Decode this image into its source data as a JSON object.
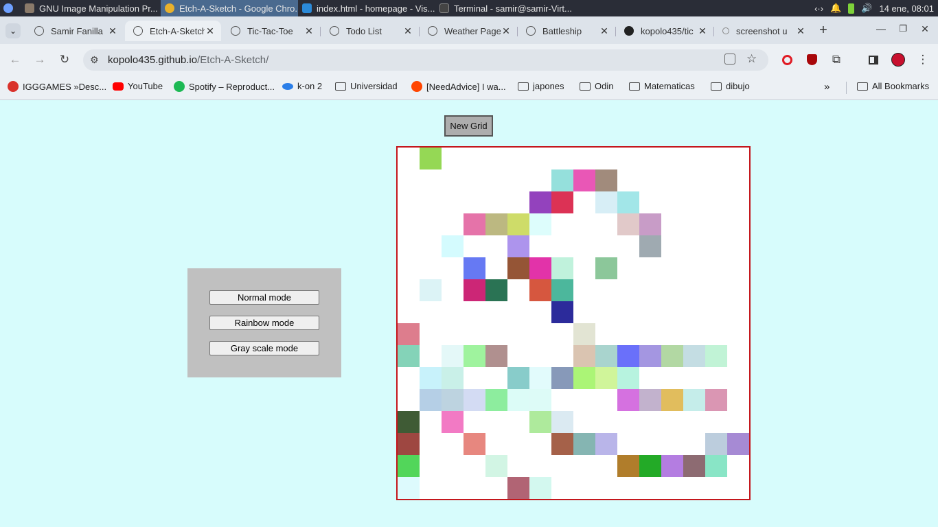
{
  "taskbar": {
    "apps": [
      {
        "label": "GNU Image Manipulation Pr...",
        "color": "#8a7a6a",
        "active": false
      },
      {
        "label": "Etch-A-Sketch - Google Chro...",
        "color": "#e8b12c",
        "active": true
      },
      {
        "label": "index.html - homepage - Vis...",
        "color": "#2b8ad8",
        "active": false
      },
      {
        "label": "Terminal - samir@samir-Virt...",
        "color": "#444444",
        "active": false
      }
    ],
    "clock": "14 ene, 08:01"
  },
  "tabs": [
    {
      "title": "Samir Fanilla",
      "active": false,
      "icon": "globe"
    },
    {
      "title": "Etch-A-Sketch",
      "active": true,
      "icon": "globe"
    },
    {
      "title": "Tic-Tac-Toe",
      "active": false,
      "icon": "globe"
    },
    {
      "title": "Todo List",
      "active": false,
      "icon": "globe"
    },
    {
      "title": "Weather Page",
      "active": false,
      "icon": "globe"
    },
    {
      "title": "Battleship",
      "active": false,
      "icon": "globe"
    },
    {
      "title": "kopolo435/tic",
      "active": false,
      "icon": "github"
    },
    {
      "title": "screenshot u",
      "active": false,
      "icon": "google"
    }
  ],
  "address_bar": {
    "host": "kopolo435.github.io",
    "path": "/Etch-A-Sketch/"
  },
  "bookmarks": [
    {
      "label": "IGGGAMES »Desc...",
      "icon": "#d9322b",
      "type": "site"
    },
    {
      "label": "YouTube",
      "icon": "#ff0000",
      "type": "site"
    },
    {
      "label": "Spotify – Reproduct...",
      "icon": "#1db954",
      "type": "site"
    },
    {
      "label": "k-on 2",
      "icon": "#2a7ee8",
      "type": "site"
    },
    {
      "label": "Universidad",
      "type": "folder"
    },
    {
      "label": "[NeedAdvice] I wa...",
      "icon": "#ff4500",
      "type": "site"
    },
    {
      "label": "japones",
      "type": "folder"
    },
    {
      "label": "Odin",
      "type": "folder"
    },
    {
      "label": "Matematicas",
      "type": "folder"
    },
    {
      "label": "dibujo",
      "type": "folder"
    }
  ],
  "all_bookmarks": "All Bookmarks",
  "page": {
    "new_grid_label": "New Grid",
    "modes": [
      "Normal mode",
      "Rainbow mode",
      "Gray scale mode"
    ]
  },
  "grid": {
    "size": 16,
    "cells": [
      [
        0,
        1,
        "#95d855"
      ],
      [
        1,
        7,
        "#95e0dc"
      ],
      [
        1,
        8,
        "#e957b6"
      ],
      [
        1,
        9,
        "#a18b7c"
      ],
      [
        2,
        6,
        "#9342bd"
      ],
      [
        2,
        7,
        "#dc3255"
      ],
      [
        2,
        9,
        "#d7eef6"
      ],
      [
        2,
        10,
        "#a2e6e8"
      ],
      [
        3,
        3,
        "#e573a9"
      ],
      [
        3,
        4,
        "#bcb881"
      ],
      [
        3,
        5,
        "#cedc69"
      ],
      [
        3,
        6,
        "#ddfdfc"
      ],
      [
        3,
        10,
        "#e1c9c9"
      ],
      [
        3,
        11,
        "#c89cc7"
      ],
      [
        4,
        2,
        "#d4fbfe"
      ],
      [
        4,
        5,
        "#ad94ed"
      ],
      [
        4,
        11,
        "#9faab1"
      ],
      [
        5,
        3,
        "#6679f3"
      ],
      [
        5,
        5,
        "#955536"
      ],
      [
        5,
        6,
        "#e233a9"
      ],
      [
        5,
        7,
        "#c0f2dc"
      ],
      [
        5,
        9,
        "#8cc79a"
      ],
      [
        6,
        1,
        "#dcf3f6"
      ],
      [
        6,
        3,
        "#cc2676"
      ],
      [
        6,
        4,
        "#2a7354"
      ],
      [
        6,
        6,
        "#d6573f"
      ],
      [
        6,
        7,
        "#4cb79c"
      ],
      [
        7,
        7,
        "#2c2b9b"
      ],
      [
        8,
        0,
        "#dd7d8d"
      ],
      [
        8,
        8,
        "#e2e4d3"
      ],
      [
        9,
        0,
        "#84d3b8"
      ],
      [
        9,
        2,
        "#e4f8f8"
      ],
      [
        9,
        3,
        "#9ff39e"
      ],
      [
        9,
        4,
        "#b0908f"
      ],
      [
        9,
        8,
        "#dac4b1"
      ],
      [
        9,
        9,
        "#a9d4ce"
      ],
      [
        9,
        10,
        "#6a70fa"
      ],
      [
        9,
        11,
        "#a496e1"
      ],
      [
        9,
        12,
        "#b2d8a3"
      ],
      [
        9,
        13,
        "#c4dde3"
      ],
      [
        9,
        14,
        "#c1f3d6"
      ],
      [
        10,
        1,
        "#c8f2fb"
      ],
      [
        10,
        2,
        "#c9f0e8"
      ],
      [
        10,
        5,
        "#88ccca"
      ],
      [
        10,
        6,
        "#e2fbfc"
      ],
      [
        10,
        7,
        "#8799b9"
      ],
      [
        10,
        8,
        "#abf576"
      ],
      [
        10,
        9,
        "#d0f59a"
      ],
      [
        10,
        10,
        "#b7f3df"
      ],
      [
        11,
        1,
        "#b5cfe6"
      ],
      [
        11,
        2,
        "#bdd3e0"
      ],
      [
        11,
        3,
        "#d3dbf3"
      ],
      [
        11,
        4,
        "#8ded9e"
      ],
      [
        11,
        5,
        "#dcfcf7"
      ],
      [
        11,
        6,
        "#ddfbf7"
      ],
      [
        11,
        10,
        "#d571e0"
      ],
      [
        11,
        11,
        "#c2b2cd"
      ],
      [
        11,
        12,
        "#e1bd5d"
      ],
      [
        11,
        13,
        "#c5edea"
      ],
      [
        11,
        14,
        "#da96b3"
      ],
      [
        12,
        0,
        "#3f5b35"
      ],
      [
        12,
        2,
        "#f27ac4"
      ],
      [
        12,
        6,
        "#aeea9c"
      ],
      [
        12,
        7,
        "#dbeaf2"
      ],
      [
        13,
        0,
        "#9e4741"
      ],
      [
        13,
        3,
        "#e7877f"
      ],
      [
        13,
        7,
        "#a56149"
      ],
      [
        13,
        8,
        "#85b5b2"
      ],
      [
        13,
        9,
        "#b9b5e9"
      ],
      [
        13,
        14,
        "#bccddd"
      ],
      [
        13,
        15,
        "#a68ad4"
      ],
      [
        14,
        0,
        "#52d65a"
      ],
      [
        14,
        4,
        "#d2f5e4"
      ],
      [
        14,
        10,
        "#b07d2b"
      ],
      [
        14,
        11,
        "#23aa27"
      ],
      [
        14,
        12,
        "#b47de1"
      ],
      [
        14,
        13,
        "#8d6b72"
      ],
      [
        14,
        14,
        "#89e5c6"
      ],
      [
        15,
        0,
        "#ddfafd"
      ],
      [
        15,
        5,
        "#b16474"
      ],
      [
        15,
        6,
        "#d3f8ef"
      ]
    ]
  }
}
